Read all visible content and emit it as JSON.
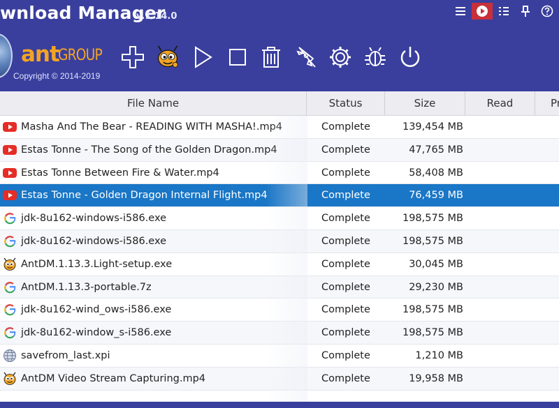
{
  "header": {
    "title": "wnload Manager",
    "version": "v.1.14.0",
    "logo_ant": "ant",
    "logo_group": "GROUP",
    "copyright": "Copyright © 2014-2019"
  },
  "colors": {
    "header_bg": "#3a3f9d",
    "selected_row": "#1a76c6",
    "logo_orange": "#f2a425",
    "active_window_button": "#c8303a"
  },
  "toolbar": {
    "buttons": [
      {
        "icon": "plus-icon"
      },
      {
        "icon": "ant-mascot-icon"
      },
      {
        "icon": "play-icon"
      },
      {
        "icon": "stop-icon"
      },
      {
        "icon": "trash-icon"
      },
      {
        "icon": "rocket-icon"
      },
      {
        "icon": "gear-icon"
      },
      {
        "icon": "bug-icon"
      },
      {
        "icon": "power-icon"
      }
    ]
  },
  "window_controls": [
    {
      "icon": "menu-icon"
    },
    {
      "icon": "video-play-icon"
    },
    {
      "icon": "grid-menu-icon"
    },
    {
      "icon": "pin-icon"
    },
    {
      "icon": "help-icon"
    }
  ],
  "table": {
    "columns": [
      "File Name",
      "Status",
      "Size",
      "Read",
      "Pr"
    ],
    "rows": [
      {
        "icon": "youtube-icon",
        "name": "Masha And The Bear - READING WITH MASHA!.mp4",
        "status": "Complete",
        "size": "139,454 MB"
      },
      {
        "icon": "youtube-icon",
        "name": "Estas Tonne - The Song of the Golden Dragon.mp4",
        "status": "Complete",
        "size": "47,765 MB"
      },
      {
        "icon": "youtube-icon",
        "name": "Estas Tonne Between Fire & Water.mp4",
        "status": "Complete",
        "size": "58,408 MB"
      },
      {
        "icon": "youtube-icon",
        "name": "Estas Tonne - Golden Dragon Internal Flight.mp4",
        "status": "Complete",
        "size": "76,459 MB"
      },
      {
        "icon": "google-icon",
        "name": "jdk-8u162-windows-i586.exe",
        "status": "Complete",
        "size": "198,575 MB"
      },
      {
        "icon": "google-icon",
        "name": "jdk-8u162-windows-i586.exe",
        "status": "Complete",
        "size": "198,575 MB"
      },
      {
        "icon": "ant-mascot-icon",
        "name": "AntDM.1.13.3.Light-setup.exe",
        "status": "Complete",
        "size": "30,045 MB"
      },
      {
        "icon": "google-icon",
        "name": "AntDM.1.13.3-portable.7z",
        "status": "Complete",
        "size": "29,230 MB"
      },
      {
        "icon": "google-icon",
        "name": "jdk-8u162-wind_ows-i586.exe",
        "status": "Complete",
        "size": "198,575 MB"
      },
      {
        "icon": "google-icon",
        "name": "jdk-8u162-window_s-i586.exe",
        "status": "Complete",
        "size": "198,575 MB"
      },
      {
        "icon": "globe-icon",
        "name": "savefrom_last.xpi",
        "status": "Complete",
        "size": "1,210 MB"
      },
      {
        "icon": "ant-mascot-icon",
        "name": "AntDM Video Stream Capturing.mp4",
        "status": "Complete",
        "size": "19,958 MB"
      }
    ]
  }
}
